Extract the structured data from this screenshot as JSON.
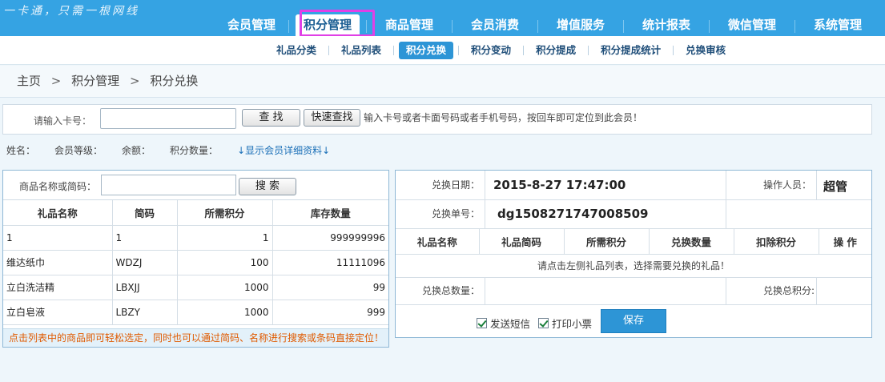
{
  "top": {
    "slogan": "一卡通，只需一根网线",
    "nav": [
      "会员管理",
      "积分管理",
      "商品管理",
      "会员消费",
      "增值服务",
      "统计报表",
      "微信管理",
      "系统管理"
    ],
    "active_index": 1
  },
  "subnav": {
    "items": [
      "礼品分类",
      "礼品列表",
      "积分兑换",
      "积分变动",
      "积分提成",
      "积分提成统计",
      "兑换审核"
    ],
    "active_index": 2
  },
  "breadcrumb": {
    "home": "主页",
    "sep": ">",
    "level1": "积分管理",
    "level2": "积分兑换"
  },
  "card_search": {
    "label": "请输入卡号：",
    "input_value": "",
    "find_btn": "查  找",
    "quick_btn": "快速查找",
    "hint": "输入卡号或者卡面号码或者手机号码，按回车即可定位到此会员！"
  },
  "member_info": {
    "name_label": "姓名：",
    "level_label": "会员等级：",
    "balance_label": "余额：",
    "points_label": "积分数量：",
    "detail_link": "↓显示会员详细资料↓"
  },
  "gift_search": {
    "label": "商品名称或简码：",
    "input_value": "",
    "search_btn": "搜  索"
  },
  "gift_table": {
    "headers": [
      "礼品名称",
      "简码",
      "所需积分",
      "库存数量"
    ],
    "rows": [
      [
        "1",
        "1",
        "1",
        "999999996"
      ],
      [
        "维达纸巾",
        "WDZJ",
        "100",
        "11111096"
      ],
      [
        "立白洗洁精",
        "LBXJJ",
        "1000",
        "99"
      ],
      [
        "立白皂液",
        "LBZY",
        "1000",
        "999"
      ]
    ],
    "note": "点击列表中的商品即可轻松选定，同时也可以通过简码、名称进行搜索或条码直接定位！"
  },
  "exchange": {
    "date_label": "兑换日期：",
    "date_value": "2015-8-27 17:47:00",
    "operator_label": "操作人员：",
    "operator_value": "超管",
    "order_label": "兑换单号：",
    "order_value": "dg1508271747008509",
    "headers": [
      "礼品名称",
      "礼品简码",
      "所需积分",
      "兑换数量",
      "扣除积分",
      "操  作"
    ],
    "empty_msg": "请点击左侧礼品列表，选择需要兑换的礼品！",
    "total_qty_label": "兑换总数量：",
    "total_points_label": "兑换总积分:",
    "sms_label": "发送短信",
    "print_label": "打印小票",
    "save_btn": "保存"
  },
  "colors": {
    "topbar": "#35a3e3",
    "accent": "#2d95d6",
    "highlight": "#e040e6",
    "note": "#e05a00"
  }
}
